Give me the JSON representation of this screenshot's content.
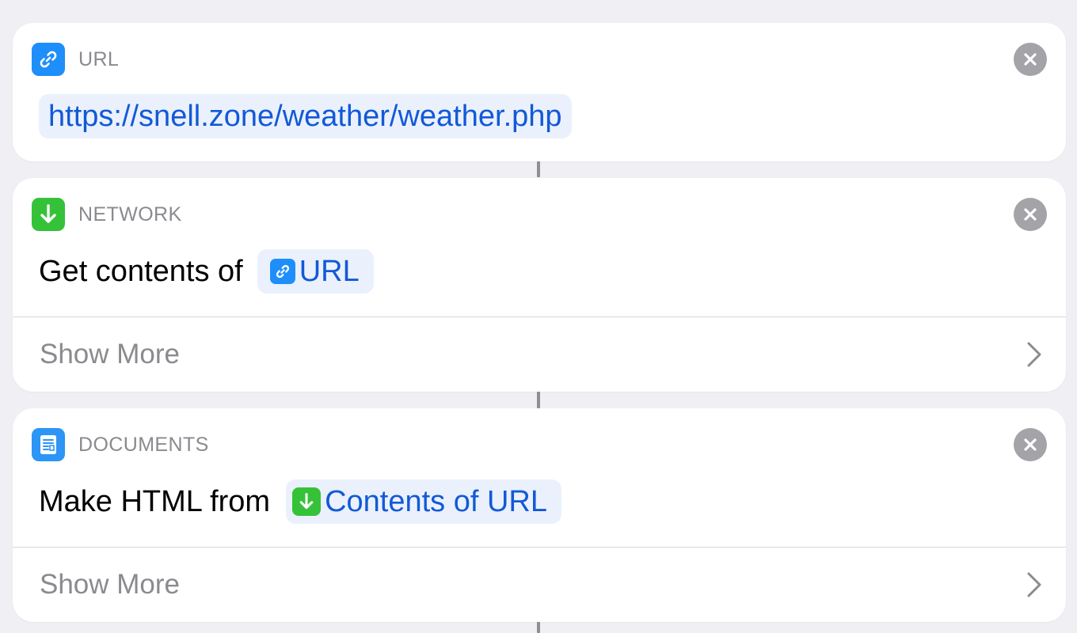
{
  "actions": [
    {
      "category": "URL",
      "icon": "link-icon",
      "url_value": "https://snell.zone/weather/weather.php"
    },
    {
      "category": "NETWORK",
      "icon": "download-arrow-icon",
      "action_text": "Get contents of",
      "variable": {
        "icon": "link-icon",
        "label": "URL"
      },
      "show_more_label": "Show More"
    },
    {
      "category": "DOCUMENTS",
      "icon": "document-icon",
      "action_text": "Make HTML from",
      "variable": {
        "icon": "download-arrow-icon",
        "label": "Contents of URL"
      },
      "show_more_label": "Show More"
    }
  ],
  "colors": {
    "background": "#efeff4",
    "card": "#ffffff",
    "token_text": "#1259d6",
    "token_bg": "#eaf1fd",
    "url_icon": "#1e8efb",
    "network_icon": "#35c238",
    "documents_icon": "#2c95f5",
    "close_button": "#a3a3a8"
  }
}
